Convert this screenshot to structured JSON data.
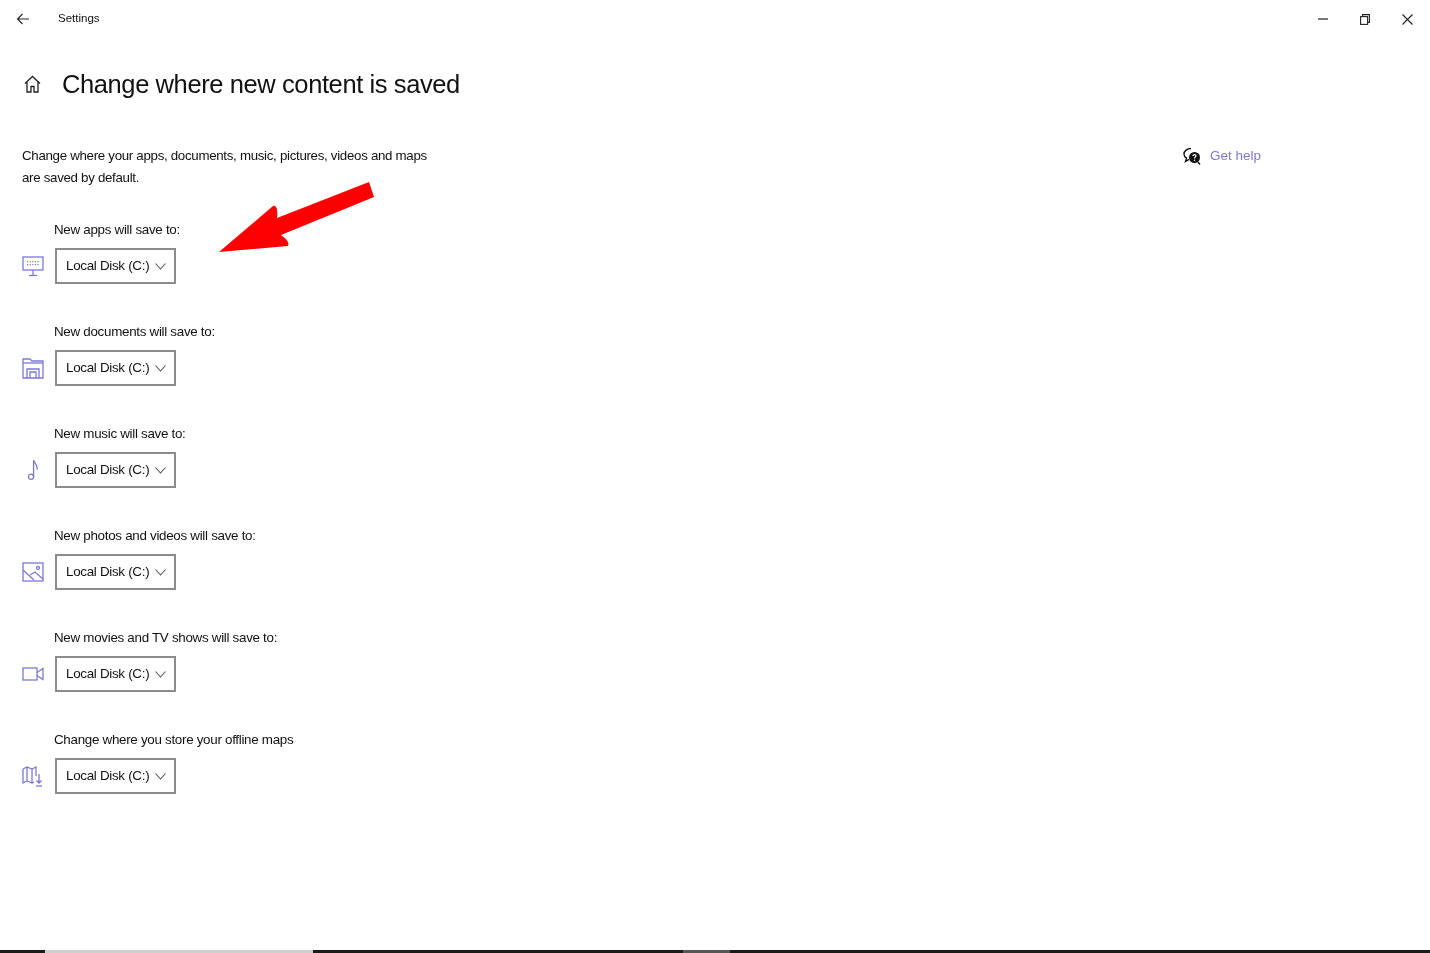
{
  "window": {
    "title": "Settings"
  },
  "page": {
    "heading": "Change where new content is saved",
    "description": "Change where your apps, documents, music, pictures, videos and maps are saved by default."
  },
  "help_link": {
    "label": "Get help"
  },
  "locations": [
    {
      "kind": "apps",
      "label": "New apps will save to:",
      "value": "Local Disk (C:)"
    },
    {
      "kind": "documents",
      "label": "New documents will save to:",
      "value": "Local Disk (C:)"
    },
    {
      "kind": "music",
      "label": "New music will save to:",
      "value": "Local Disk (C:)"
    },
    {
      "kind": "photos",
      "label": "New photos and videos will save to:",
      "value": "Local Disk (C:)"
    },
    {
      "kind": "movies",
      "label": "New movies and TV shows will save to:",
      "value": "Local Disk (C:)"
    },
    {
      "kind": "maps",
      "label": "Change where you store your offline maps",
      "value": "Local Disk (C:)"
    }
  ]
}
